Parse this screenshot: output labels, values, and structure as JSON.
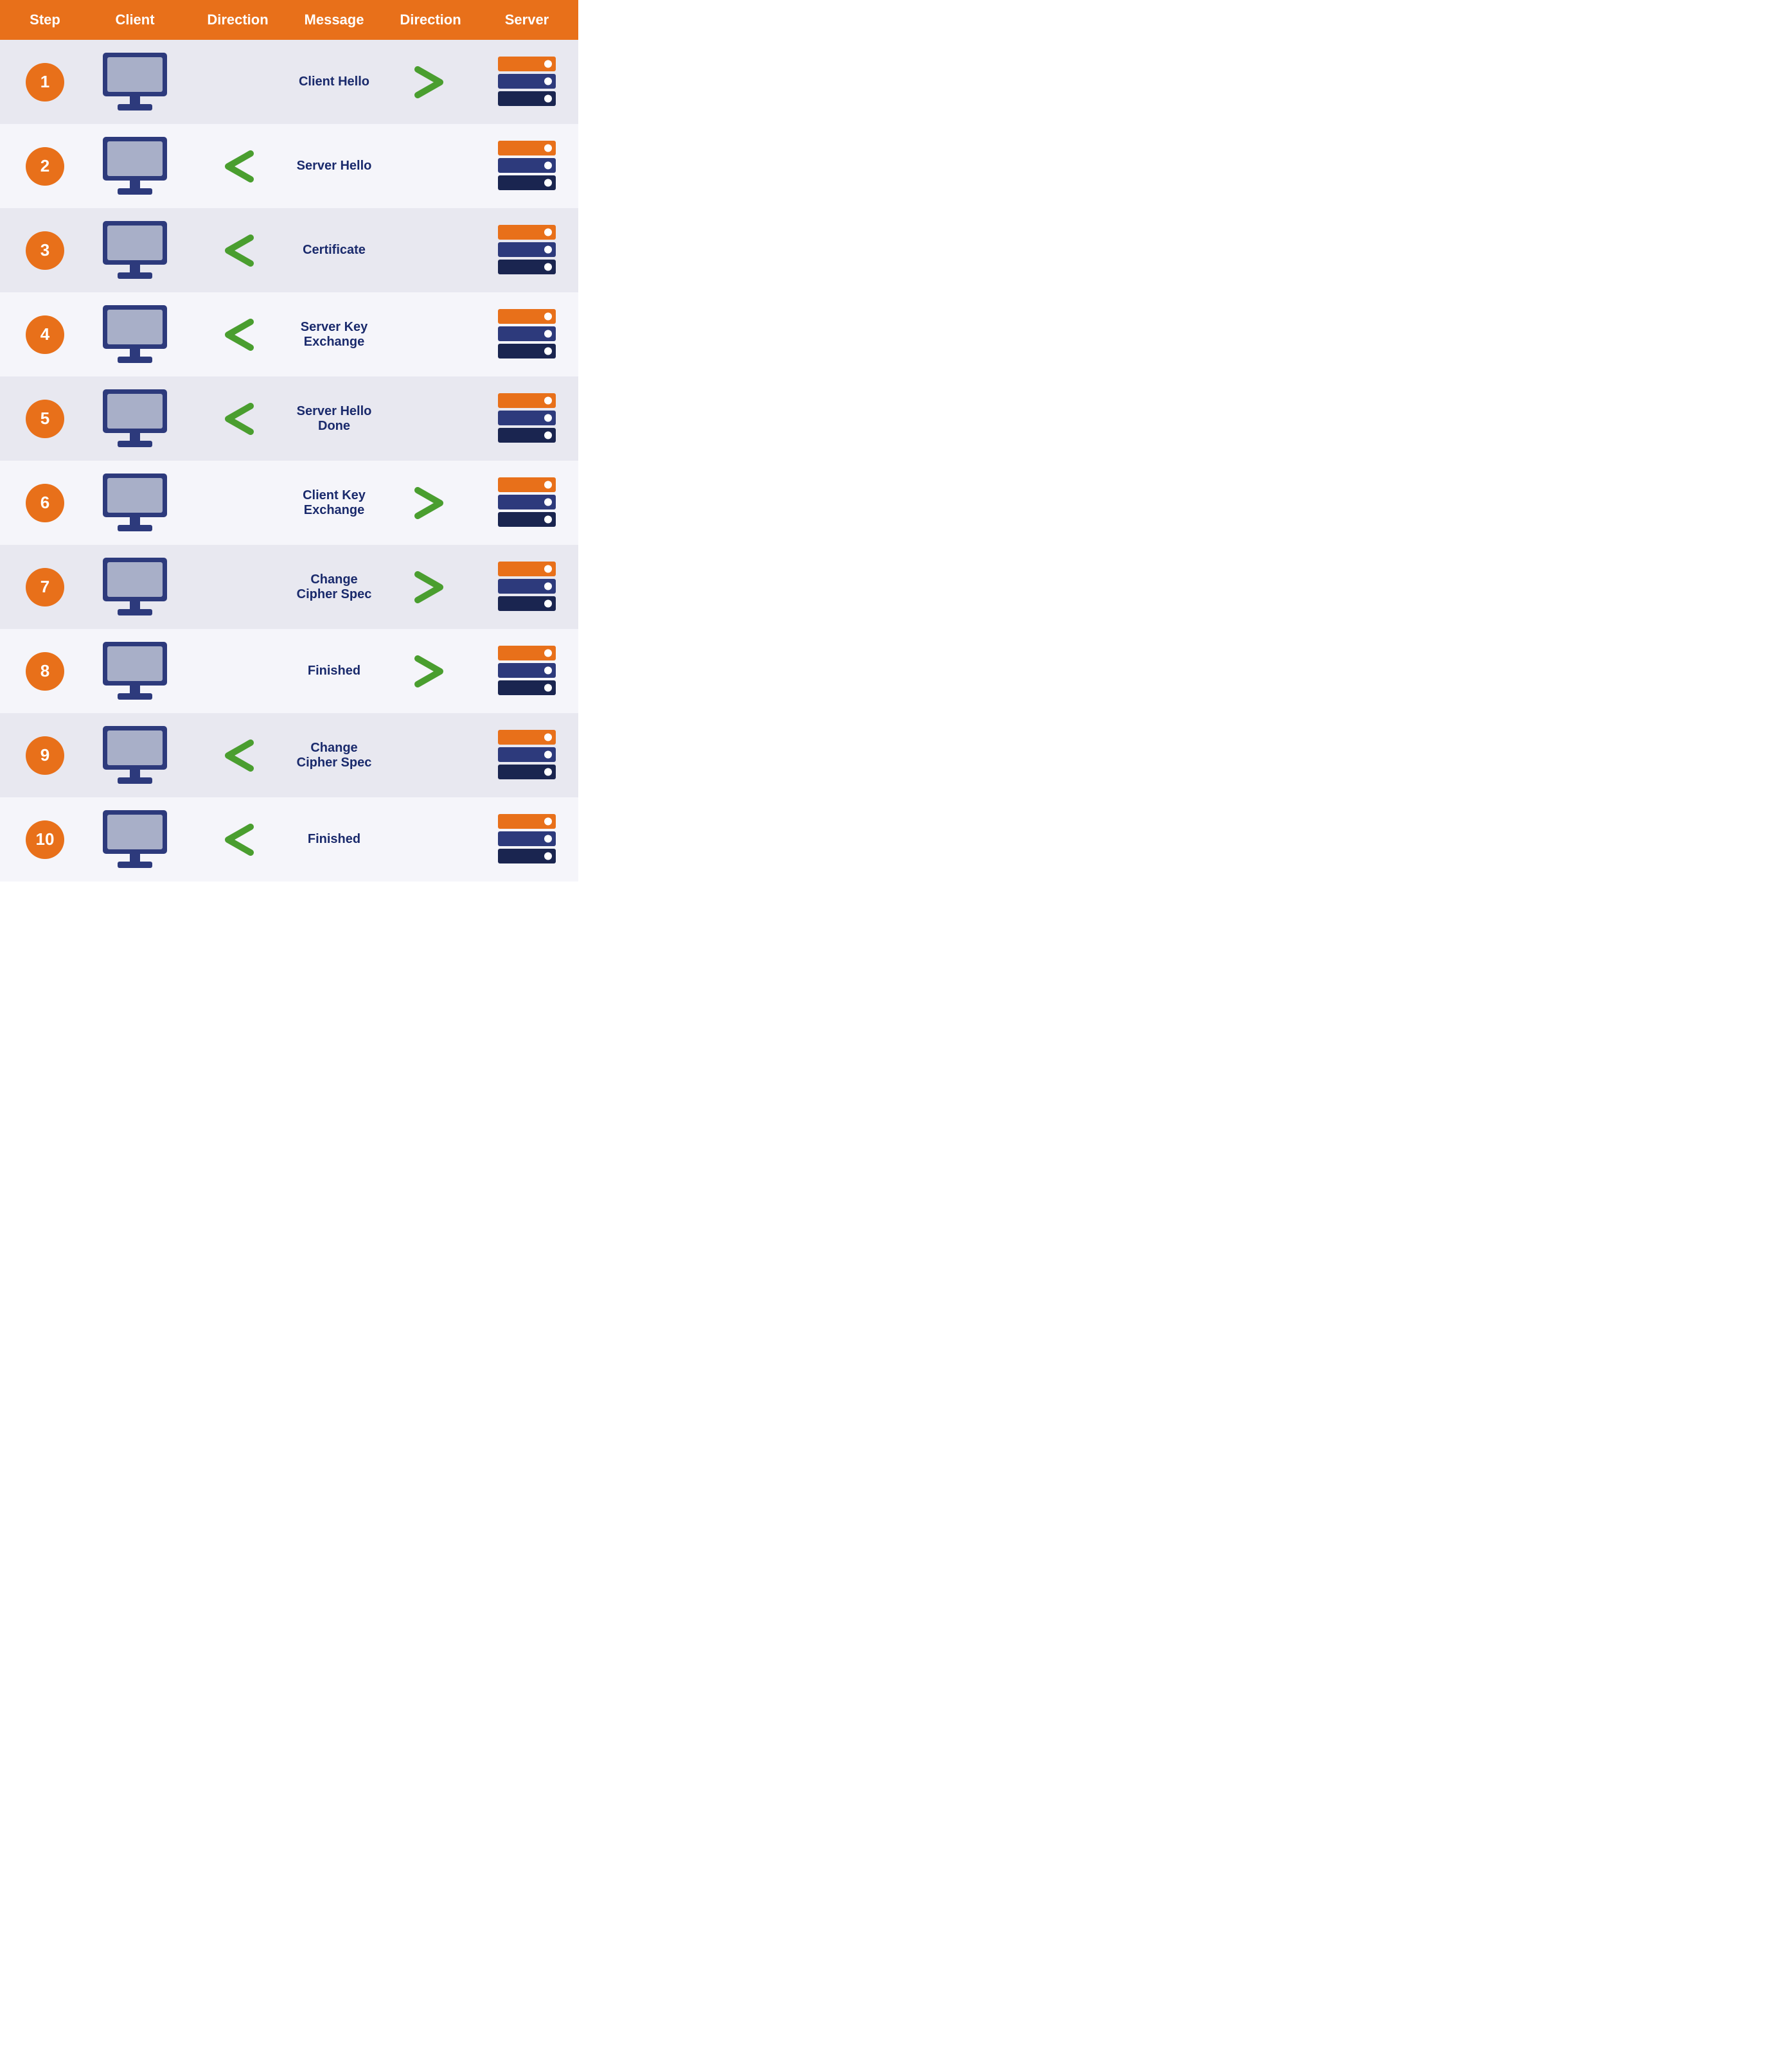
{
  "header": {
    "step": "Step",
    "client": "Client",
    "direction_left": "Direction",
    "message": "Message",
    "direction_right": "Direction",
    "server": "Server"
  },
  "rows": [
    {
      "step": "1",
      "message": "Client Hello",
      "direction": "right"
    },
    {
      "step": "2",
      "message": "Server Hello",
      "direction": "left"
    },
    {
      "step": "3",
      "message": "Certificate",
      "direction": "left"
    },
    {
      "step": "4",
      "message": "Server Key Exchange",
      "direction": "left"
    },
    {
      "step": "5",
      "message": "Server Hello Done",
      "direction": "left"
    },
    {
      "step": "6",
      "message": "Client Key Exchange",
      "direction": "right"
    },
    {
      "step": "7",
      "message": "Change Cipher Spec",
      "direction": "right"
    },
    {
      "step": "8",
      "message": "Finished",
      "direction": "right"
    },
    {
      "step": "9",
      "message": "Change Cipher Spec",
      "direction": "left"
    },
    {
      "step": "10",
      "message": "Finished",
      "direction": "left"
    }
  ],
  "colors": {
    "orange": "#E8701A",
    "navy": "#1a2a6c",
    "green": "#4a9e2f",
    "header_text": "#ffffff"
  }
}
